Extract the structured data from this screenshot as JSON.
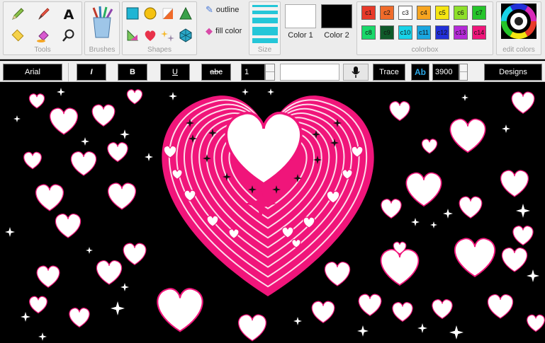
{
  "tools": {
    "group_label": "Tools",
    "items": [
      {
        "name": "pencil-icon"
      },
      {
        "name": "brush-marker-icon"
      },
      {
        "name": "text-tool-icon"
      },
      {
        "name": "eraser-icon"
      },
      {
        "name": "fill-bucket-icon"
      },
      {
        "name": "magnifier-icon"
      }
    ]
  },
  "brushes": {
    "group_label": "Brushes"
  },
  "shapes": {
    "group_label": "Shapes",
    "items": [
      {
        "name": "square-shape-icon"
      },
      {
        "name": "circle-shape-icon"
      },
      {
        "name": "right-triangle-shape-icon"
      },
      {
        "name": "triangle-shape-icon"
      },
      {
        "name": "gradient-triangle-icon"
      },
      {
        "name": "heart-shape-icon"
      },
      {
        "name": "sparkles-shape-icon"
      },
      {
        "name": "polyhedron-shape-icon"
      }
    ]
  },
  "outline": {
    "label": "outline"
  },
  "fill": {
    "label": "fill color"
  },
  "size": {
    "group_label": "Size"
  },
  "colors": {
    "color1_label": "Color 1",
    "color2_label": "Color 2",
    "color1": "#ffffff",
    "color2": "#000000"
  },
  "colorbox": {
    "group_label": "colorbox",
    "swatches": [
      {
        "label": "c1",
        "color": "#e83a2a"
      },
      {
        "label": "c2",
        "color": "#f06b2a"
      },
      {
        "label": "c3",
        "color": "#ffffff"
      },
      {
        "label": "c4",
        "color": "#f7a520"
      },
      {
        "label": "c5",
        "color": "#f5e512"
      },
      {
        "label": "c6",
        "color": "#8ee02a"
      },
      {
        "label": "c7",
        "color": "#25c52a"
      },
      {
        "label": "c8",
        "color": "#19d86a"
      },
      {
        "label": "c9",
        "color": "#0f5a2a"
      },
      {
        "label": "c10",
        "color": "#18d3e8"
      },
      {
        "label": "c11",
        "color": "#1aa6e0"
      },
      {
        "label": "c12",
        "color": "#2230d8"
      },
      {
        "label": "c13",
        "color": "#b52ad8"
      },
      {
        "label": "c14",
        "color": "#f0157a"
      }
    ]
  },
  "edit_colors": {
    "label": "edit colors"
  },
  "toolbar2": {
    "font": "Arial",
    "italic": "I",
    "bold": "B",
    "underline": "U",
    "strike": "abc",
    "font_size": "1",
    "trace": "Trace",
    "ab": "Ab",
    "number": "3900",
    "designs": "Designs"
  },
  "accent_pink": "#f0157a"
}
